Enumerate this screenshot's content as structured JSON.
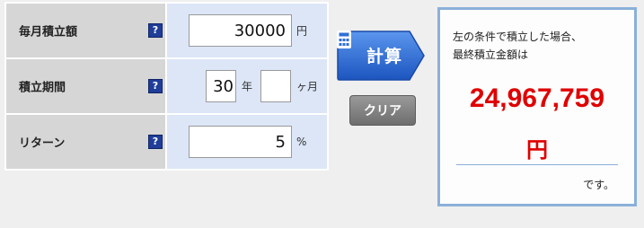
{
  "form": {
    "monthly": {
      "label": "毎月積立額",
      "help": "?",
      "value": "30000",
      "unit": "円"
    },
    "period": {
      "label": "積立期間",
      "help": "?",
      "years_value": "30",
      "years_unit": "年",
      "months_value": "",
      "months_unit": "ヶ月"
    },
    "return": {
      "label": "リターン",
      "help": "?",
      "value": "5",
      "unit": "%"
    }
  },
  "buttons": {
    "calculate_label": "計算",
    "clear_label": "クリア"
  },
  "result": {
    "lead_line1": "左の条件で積立した場合、",
    "lead_line2": "最終積立金額は",
    "amount": "24,967,759",
    "unit": "円",
    "tail": "です。"
  },
  "colors": {
    "accent_blue": "#2f6fd6",
    "result_red": "#e00000",
    "help_icon": "#1f3d99"
  }
}
